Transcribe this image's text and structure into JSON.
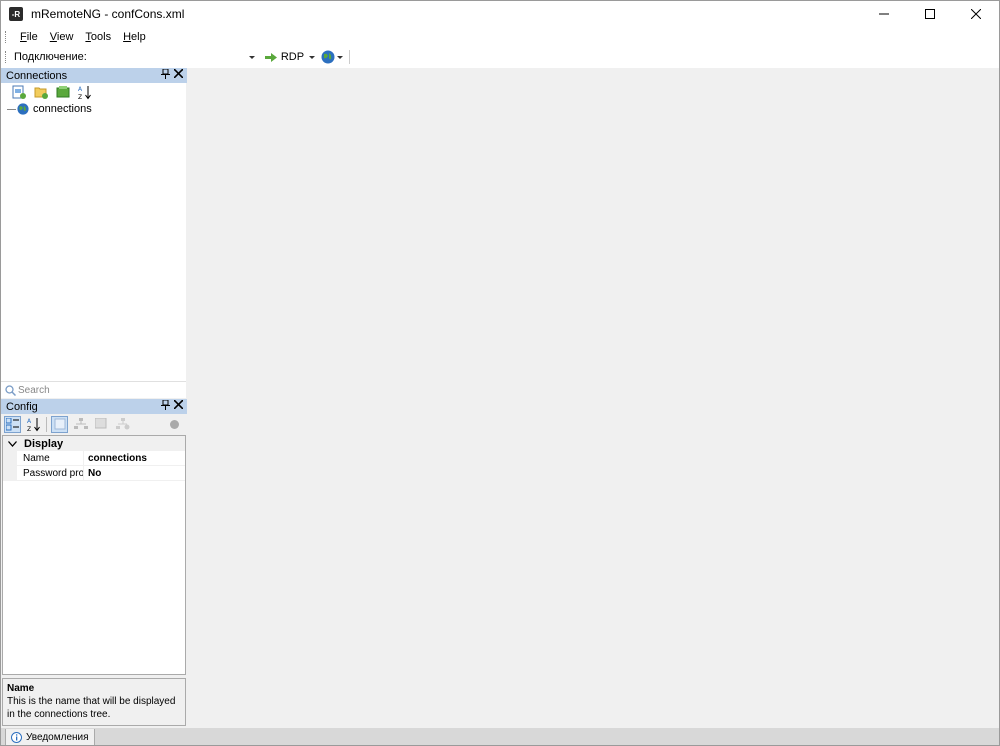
{
  "window": {
    "app_icon_text": "-R",
    "title": "mRemoteNG - confCons.xml"
  },
  "menu": {
    "items": [
      {
        "underline": "F",
        "rest": "ile"
      },
      {
        "underline": "V",
        "rest": "iew"
      },
      {
        "underline": "T",
        "rest": "ools"
      },
      {
        "underline": "H",
        "rest": "elp"
      }
    ]
  },
  "toolbar": {
    "connect_label": "Подключение:",
    "combo_value": "",
    "protocol_label": "RDP"
  },
  "connections_panel": {
    "title": "Connections",
    "tree": [
      {
        "label": "connections",
        "icon": "globe-icon"
      }
    ],
    "search_placeholder": "Search"
  },
  "config_panel": {
    "title": "Config",
    "category": "Display",
    "rows": [
      {
        "name": "Name",
        "value": "connections"
      },
      {
        "name": "Password protection",
        "value": "No"
      }
    ],
    "description_title": "Name",
    "description_text": "This is the name that will be displayed in the connections tree."
  },
  "bottom_tab": {
    "label": "Уведомления"
  },
  "colors": {
    "panel_header": "#bcd1ea",
    "background": "#f0f0f0",
    "accent": "#2c6fbf"
  }
}
